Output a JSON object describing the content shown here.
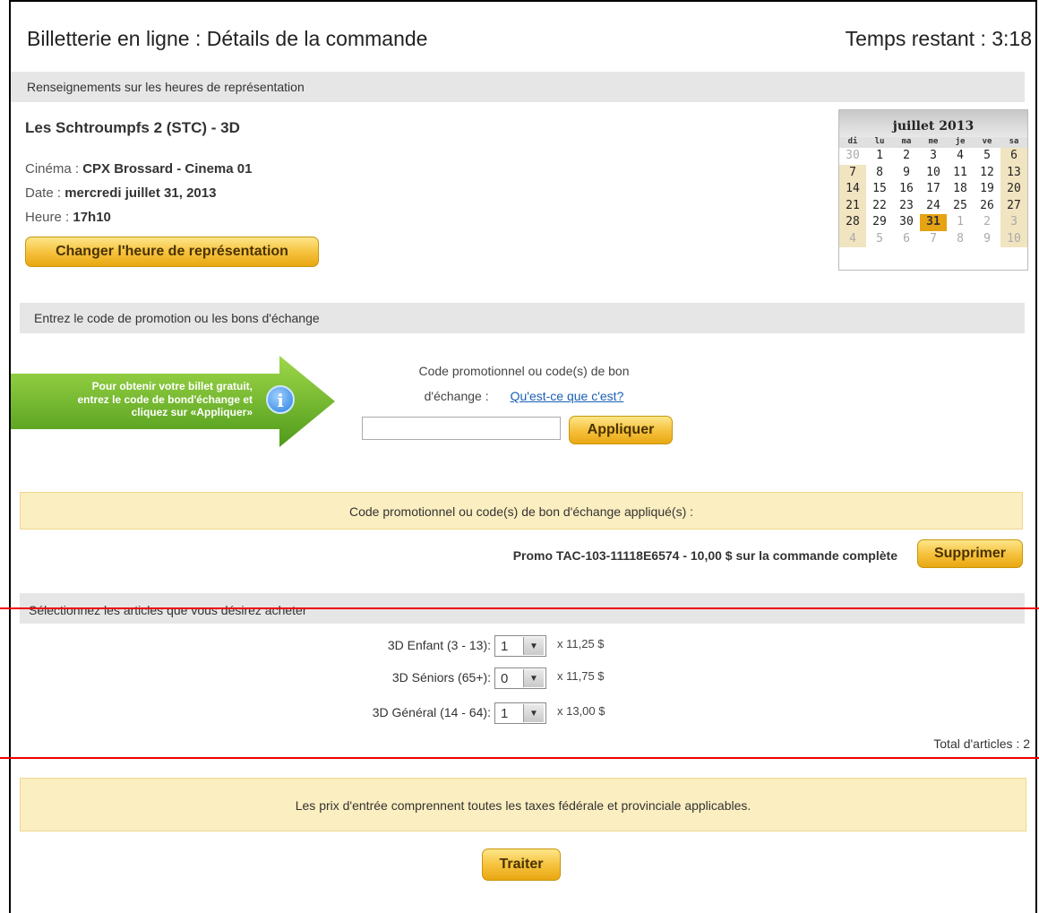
{
  "header": {
    "title": "Billetterie en ligne : Détails de la commande",
    "timer": "Temps restant : 3:18"
  },
  "showtime": {
    "section_title": "Renseignements sur les heures de représentation",
    "movie_title": "Les Schtroumpfs 2 (STC) - 3D",
    "cinema_label": "Cinéma : ",
    "cinema_value": "CPX Brossard - Cinema 01",
    "date_label": "Date : ",
    "date_value": "mercredi juillet 31, 2013",
    "time_label": "Heure : ",
    "time_value": "17h10",
    "change_button": "Changer l'heure de représentation"
  },
  "calendar": {
    "month": "juillet 2013",
    "dows": [
      "di",
      "lu",
      "ma",
      "me",
      "je",
      "ve",
      "sa"
    ],
    "days": [
      {
        "d": "30",
        "m": true
      },
      {
        "d": "1"
      },
      {
        "d": "2"
      },
      {
        "d": "3"
      },
      {
        "d": "4"
      },
      {
        "d": "5"
      },
      {
        "d": "6",
        "w": true
      },
      {
        "d": "7",
        "w": true
      },
      {
        "d": "8"
      },
      {
        "d": "9"
      },
      {
        "d": "10"
      },
      {
        "d": "11"
      },
      {
        "d": "12"
      },
      {
        "d": "13",
        "w": true
      },
      {
        "d": "14",
        "w": true
      },
      {
        "d": "15"
      },
      {
        "d": "16"
      },
      {
        "d": "17"
      },
      {
        "d": "18"
      },
      {
        "d": "19"
      },
      {
        "d": "20",
        "w": true
      },
      {
        "d": "21",
        "w": true
      },
      {
        "d": "22"
      },
      {
        "d": "23"
      },
      {
        "d": "24"
      },
      {
        "d": "25"
      },
      {
        "d": "26"
      },
      {
        "d": "27",
        "w": true
      },
      {
        "d": "28",
        "w": true
      },
      {
        "d": "29"
      },
      {
        "d": "30"
      },
      {
        "d": "31",
        "sel": true
      },
      {
        "d": "1",
        "m": true
      },
      {
        "d": "2",
        "m": true
      },
      {
        "d": "3",
        "m": true,
        "w": true
      },
      {
        "d": "4",
        "m": true,
        "w": true
      },
      {
        "d": "5",
        "m": true
      },
      {
        "d": "6",
        "m": true
      },
      {
        "d": "7",
        "m": true
      },
      {
        "d": "8",
        "m": true
      },
      {
        "d": "9",
        "m": true
      },
      {
        "d": "10",
        "m": true,
        "w": true
      }
    ]
  },
  "promo": {
    "section_title": "Entrez le code de promotion ou les bons d'échange",
    "arrow_line1": "Pour obtenir votre billet gratuit,",
    "arrow_line2": "entrez le code de bond'échange et",
    "arrow_line3": "cliquez sur «Appliquer»",
    "info_icon": "i",
    "label_line1": "Code promotionnel ou code(s) de bon",
    "label_line2": "d'échange :",
    "help_link": "Qu'est-ce que c'est?",
    "input_value": "",
    "apply_button": "Appliquer",
    "applied_title": "Code promotionnel ou code(s) de bon d'échange appliqué(s) :",
    "applied_item": "Promo TAC-103-11118E6574 - 10,00 $ sur la commande complète",
    "remove_button": "Supprimer"
  },
  "items": {
    "section_title": "Sélectionnez les articles que vous désirez acheter",
    "rows": [
      {
        "label": "3D Enfant (3 - 13):",
        "qty": "1",
        "price": "x 11,25 $"
      },
      {
        "label": "3D Séniors (65+):",
        "qty": "0",
        "price": "x 11,75 $"
      },
      {
        "label": "3D Général (14 - 64):",
        "qty": "1",
        "price": "x 13,00 $"
      }
    ],
    "total": "Total d'articles : 2"
  },
  "footer": {
    "tax_notice": "Les prix d'entrée comprennent toutes les taxes fédérale et provinciale applicables.",
    "process_button": "Traiter"
  },
  "colors": {
    "accent_gold": "#f6c340",
    "notice_bg": "#fbeec0",
    "section_bg": "#e6e6e6",
    "annotation_red": "#e00000",
    "arrow_green": "#6dbb2a"
  }
}
